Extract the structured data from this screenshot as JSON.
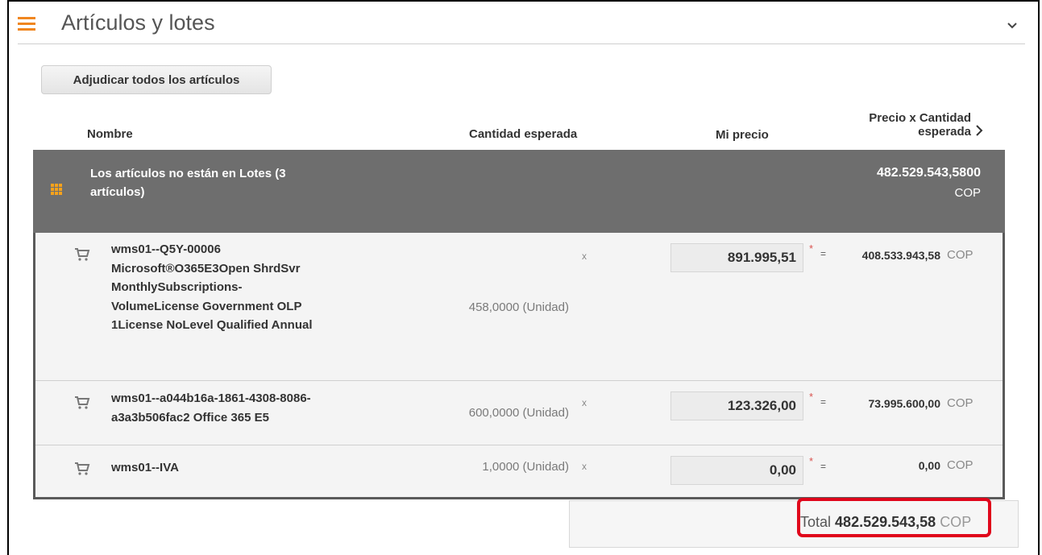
{
  "section": {
    "title": "Artículos y lotes",
    "icon": "list-icon",
    "collapse_icon": "chevron-down-icon"
  },
  "buttons": {
    "award_all": "Adjudicar todos los artículos"
  },
  "columns": {
    "name": "Nombre",
    "expected_qty": "Cantidad esperada",
    "my_price": "Mi precio",
    "price_x_qty_line1": "Precio x Cantidad",
    "price_x_qty_line2": "esperada"
  },
  "group": {
    "label_line1": "Los artículos no están en Lotes (3",
    "label_line2": "artículos)",
    "amount": "482.529.543,5800",
    "currency": "COP"
  },
  "items": [
    {
      "name_lines": [
        "wms01--Q5Y-00006",
        "Microsoft®O365E3Open ShrdSvr",
        "MonthlySubscriptions-",
        "VolumeLicense Government OLP",
        "1License NoLevel Qualified Annual"
      ],
      "qty": "458,0000 (Unidad)",
      "times": "x",
      "price": "891.995,51",
      "asterisk": "*",
      "equals": "=",
      "line_total": "408.533.943,58",
      "currency": "COP"
    },
    {
      "name_lines": [
        "wms01--a044b16a-1861-4308-8086-",
        "a3a3b506fac2 Office 365 E5"
      ],
      "qty": "600,0000 (Unidad)",
      "times": "x",
      "price": "123.326,00",
      "asterisk": "*",
      "equals": "=",
      "line_total": "73.995.600,00",
      "currency": "COP"
    },
    {
      "name_lines": [
        "wms01--IVA"
      ],
      "qty": "1,0000 (Unidad)",
      "times": "x",
      "price": "0,00",
      "asterisk": "*",
      "equals": "=",
      "line_total": "0,00",
      "currency": "COP"
    }
  ],
  "total": {
    "label": "Total",
    "amount": "482.529.543,58",
    "currency": "COP"
  },
  "colors": {
    "accent_orange": "#f0861f",
    "group_bg": "#6e6e6e",
    "highlight_red": "#e0061b"
  }
}
